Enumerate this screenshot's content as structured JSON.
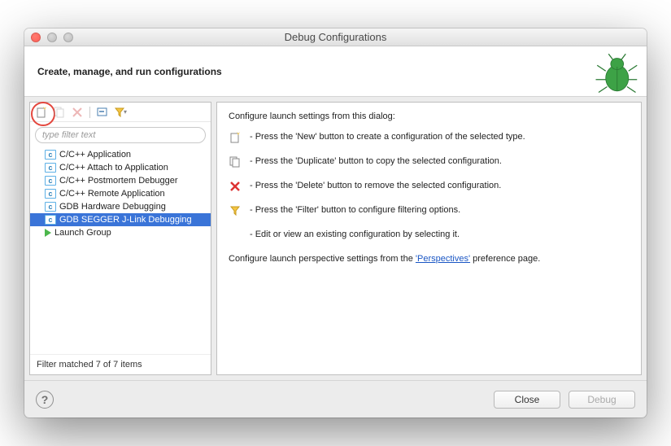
{
  "window": {
    "title": "Debug Configurations"
  },
  "header": {
    "title": "Create, manage, and run configurations"
  },
  "toolbar": {
    "new": "new-config",
    "duplicate": "duplicate-config",
    "delete": "delete-config",
    "collapse": "collapse-all",
    "filter": "filter-toggle"
  },
  "filter": {
    "placeholder": "type filter text"
  },
  "tree": {
    "items": [
      {
        "label": "C/C++ Application",
        "icon": "c",
        "selected": false
      },
      {
        "label": "C/C++ Attach to Application",
        "icon": "c",
        "selected": false
      },
      {
        "label": "C/C++ Postmortem Debugger",
        "icon": "c",
        "selected": false
      },
      {
        "label": "C/C++ Remote Application",
        "icon": "c",
        "selected": false
      },
      {
        "label": "GDB Hardware Debugging",
        "icon": "c",
        "selected": false
      },
      {
        "label": "GDB SEGGER J-Link Debugging",
        "icon": "c",
        "selected": true
      },
      {
        "label": "Launch Group",
        "icon": "launch",
        "selected": false
      }
    ],
    "status": "Filter matched 7 of 7 items"
  },
  "instructions": {
    "intro": "Configure launch settings from this dialog:",
    "rows": [
      {
        "icon": "new",
        "text": "- Press the 'New' button to create a configuration of the selected type."
      },
      {
        "icon": "duplicate",
        "text": "- Press the 'Duplicate' button to copy the selected configuration."
      },
      {
        "icon": "delete",
        "text": "- Press the 'Delete' button to remove the selected configuration."
      },
      {
        "icon": "filter",
        "text": "- Press the 'Filter' button to configure filtering options."
      },
      {
        "icon": "none",
        "text": "- Edit or view an existing configuration by selecting it."
      }
    ],
    "footer_pre": "Configure launch perspective settings from the ",
    "footer_link": "'Perspectives'",
    "footer_post": " preference page."
  },
  "buttons": {
    "close": "Close",
    "debug": "Debug"
  }
}
